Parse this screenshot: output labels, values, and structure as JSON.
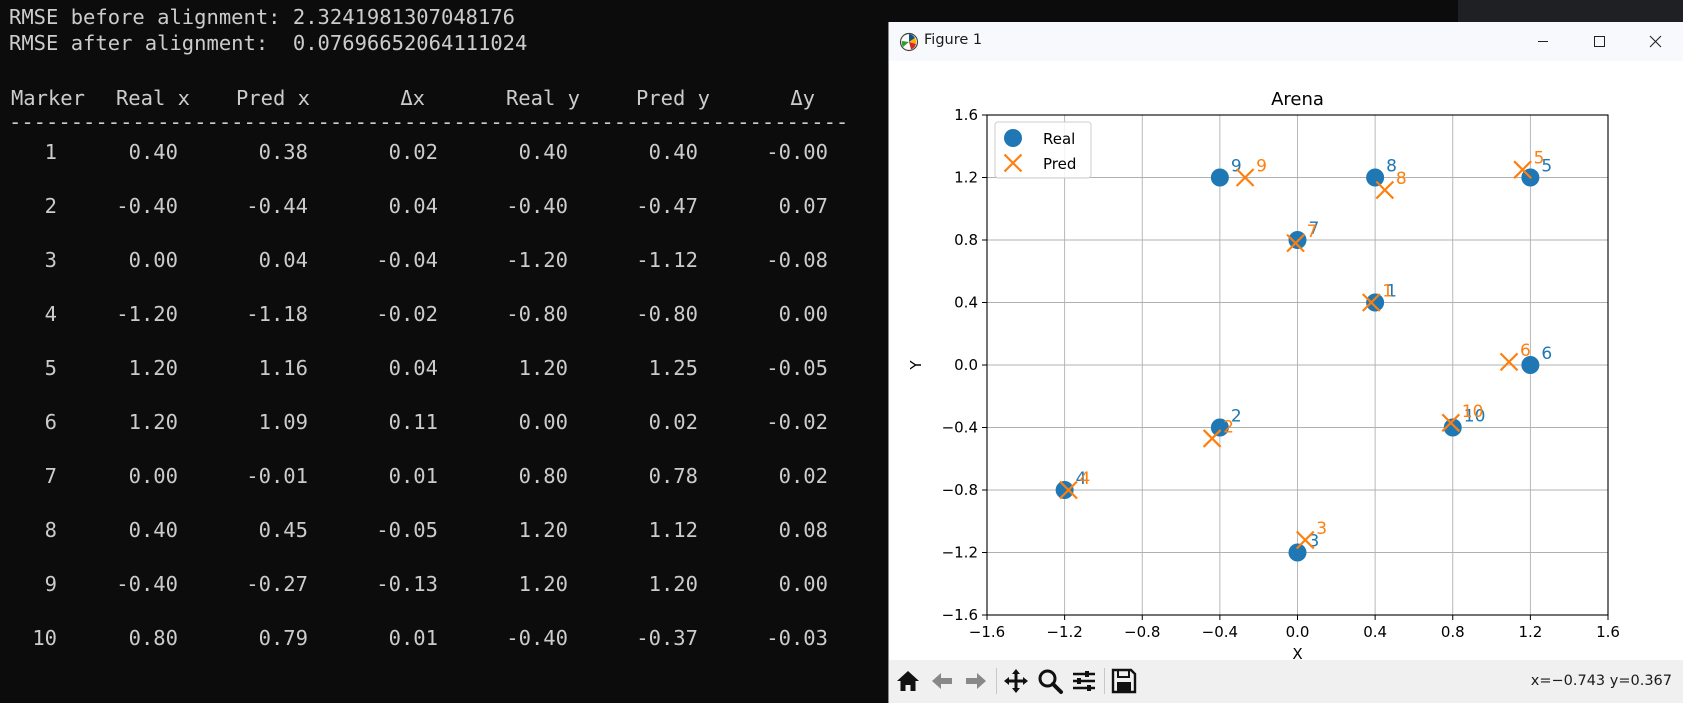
{
  "terminal": {
    "rmse_before": "RMSE before alignment: 2.3241981307048176",
    "rmse_after": "RMSE after alignment:  0.07696652064111024",
    "headers": [
      "Marker",
      "Real x",
      "Pred x",
      "Δx",
      "Real y",
      "Pred y",
      "Δy"
    ],
    "separator": "--------------------------------------------------------------------",
    "rows": [
      [
        "1",
        "0.40",
        "0.38",
        "0.02",
        "0.40",
        "0.40",
        "-0.00"
      ],
      [
        "2",
        "-0.40",
        "-0.44",
        "0.04",
        "-0.40",
        "-0.47",
        "0.07"
      ],
      [
        "3",
        "0.00",
        "0.04",
        "-0.04",
        "-1.20",
        "-1.12",
        "-0.08"
      ],
      [
        "4",
        "-1.20",
        "-1.18",
        "-0.02",
        "-0.80",
        "-0.80",
        "0.00"
      ],
      [
        "5",
        "1.20",
        "1.16",
        "0.04",
        "1.20",
        "1.25",
        "-0.05"
      ],
      [
        "6",
        "1.20",
        "1.09",
        "0.11",
        "0.00",
        "0.02",
        "-0.02"
      ],
      [
        "7",
        "0.00",
        "-0.01",
        "0.01",
        "0.80",
        "0.78",
        "0.02"
      ],
      [
        "8",
        "0.40",
        "0.45",
        "-0.05",
        "1.20",
        "1.12",
        "0.08"
      ],
      [
        "9",
        "-0.40",
        "-0.27",
        "-0.13",
        "1.20",
        "1.20",
        "0.00"
      ],
      [
        "10",
        "0.80",
        "0.79",
        "0.01",
        "-0.40",
        "-0.37",
        "-0.03"
      ]
    ]
  },
  "window": {
    "title": "Figure 1",
    "icons": {
      "app": "matplotlib-icon",
      "minimize": "minimize-icon",
      "maximize": "maximize-icon",
      "close": "close-icon"
    }
  },
  "toolbar": {
    "buttons": [
      "home-icon",
      "back-arrow-icon",
      "forward-arrow-icon",
      "pan-icon",
      "zoom-icon",
      "configure-subplots-icon",
      "save-icon"
    ],
    "coord_readout": "x=−0.743 y=0.367"
  },
  "chart_data": {
    "type": "scatter",
    "title": "Arena",
    "xlabel": "X",
    "ylabel": "Y",
    "xlim": [
      -1.6,
      1.6
    ],
    "ylim": [
      -1.6,
      1.6
    ],
    "xticks": [
      "−1.6",
      "−1.2",
      "−0.8",
      "−0.4",
      "0.0",
      "0.4",
      "0.8",
      "1.2",
      "1.6"
    ],
    "yticks": [
      "−1.6",
      "−1.2",
      "−0.8",
      "−0.4",
      "0.0",
      "0.4",
      "0.8",
      "1.2",
      "1.6"
    ],
    "grid": true,
    "legend_position": "top-left",
    "series": [
      {
        "name": "Real",
        "marker": "circle",
        "color": "#1f77b4",
        "points": [
          {
            "label": "1",
            "x": 0.4,
            "y": 0.4
          },
          {
            "label": "2",
            "x": -0.4,
            "y": -0.4
          },
          {
            "label": "3",
            "x": 0.0,
            "y": -1.2
          },
          {
            "label": "4",
            "x": -1.2,
            "y": -0.8
          },
          {
            "label": "5",
            "x": 1.2,
            "y": 1.2
          },
          {
            "label": "6",
            "x": 1.2,
            "y": 0.0
          },
          {
            "label": "7",
            "x": 0.0,
            "y": 0.8
          },
          {
            "label": "8",
            "x": 0.4,
            "y": 1.2
          },
          {
            "label": "9",
            "x": -0.4,
            "y": 1.2
          },
          {
            "label": "10",
            "x": 0.8,
            "y": -0.4
          }
        ]
      },
      {
        "name": "Pred",
        "marker": "x",
        "color": "#ff7f0e",
        "points": [
          {
            "label": "1",
            "x": 0.38,
            "y": 0.4
          },
          {
            "label": "2",
            "x": -0.44,
            "y": -0.47
          },
          {
            "label": "3",
            "x": 0.04,
            "y": -1.12
          },
          {
            "label": "4",
            "x": -1.18,
            "y": -0.8
          },
          {
            "label": "5",
            "x": 1.16,
            "y": 1.25
          },
          {
            "label": "6",
            "x": 1.09,
            "y": 0.02
          },
          {
            "label": "7",
            "x": -0.01,
            "y": 0.78
          },
          {
            "label": "8",
            "x": 0.45,
            "y": 1.12
          },
          {
            "label": "9",
            "x": -0.27,
            "y": 1.2
          },
          {
            "label": "10",
            "x": 0.79,
            "y": -0.37
          }
        ]
      }
    ]
  }
}
